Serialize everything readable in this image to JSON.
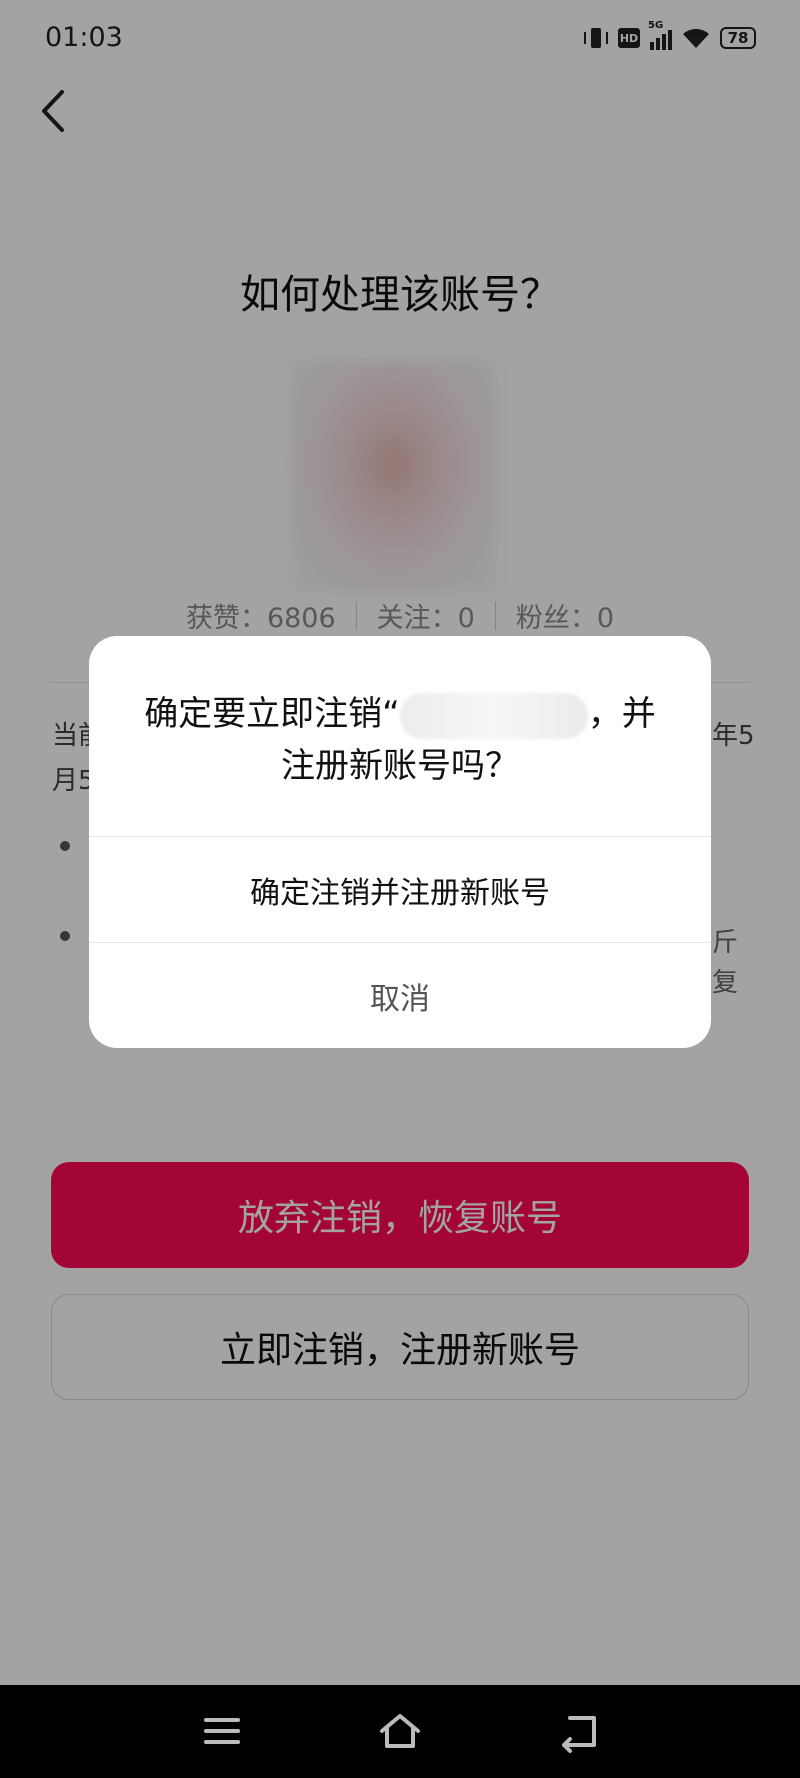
{
  "status_bar": {
    "time": "01:03",
    "hd": "HD",
    "network": "5G",
    "battery": "78",
    "icons": [
      "vibrate-icon",
      "hd-icon",
      "5g-signal-icon",
      "wifi-icon",
      "battery-icon"
    ]
  },
  "header": {
    "back_icon": "chevron-left-icon"
  },
  "page": {
    "title": "如何处理该账号？",
    "stats": {
      "likes": "获赞：6806",
      "following": "关注：0",
      "fans": "粉丝：0"
    },
    "info_fragments": {
      "line1_left": "当前",
      "line1_right": "年5",
      "line2_left": "月5",
      "bullet2_right_a": "斤",
      "bullet2_right_b": "复"
    },
    "primary_button": "放弃注销，恢复账号",
    "secondary_button": "立即注销，注册新账号"
  },
  "dialog": {
    "title_prefix": "确定要立即注销“",
    "title_suffix": "，并",
    "title_line2": "注册新账号吗？",
    "confirm_label": "确定注销并注册新账号",
    "cancel_label": "取消"
  },
  "nav_bar": {
    "icons": [
      "menu-icon",
      "home-icon",
      "back-icon"
    ]
  },
  "colors": {
    "accent": "#ff0a54",
    "overlay": "rgba(0,0,0,0.36)",
    "nav_bar": "#000000"
  }
}
